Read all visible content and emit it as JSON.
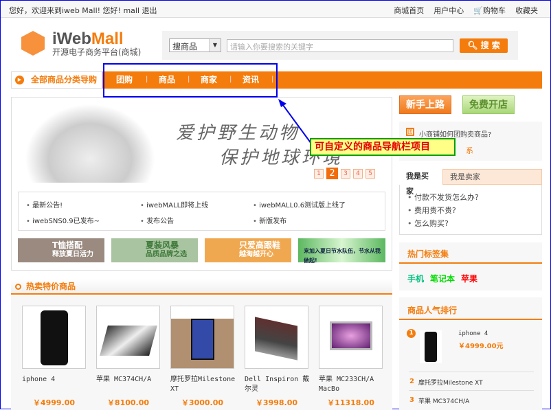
{
  "topbar": {
    "welcome": "您好，欢迎来到iweb Mall!  您好! mall 退出",
    "links": [
      "商城首页",
      "用户中心",
      "购物车",
      "收藏夹"
    ]
  },
  "logo": {
    "brand_a": "iWeb",
    "brand_b": "Mall",
    "subtitle": "开源电子商务平台(商城)"
  },
  "search": {
    "type": "搜商品",
    "placeholder": "请输入你要搜索的关键字",
    "button": "搜 索"
  },
  "nav": {
    "category": "全部商品分类导购",
    "items": [
      "团购",
      "商品",
      "商家",
      "资讯"
    ]
  },
  "banner": {
    "line1": "爱护野生动物",
    "line2": "保护地球环境",
    "pages": [
      "1",
      "2",
      "3",
      "4",
      "5"
    ],
    "active_page": "2"
  },
  "notices": [
    "最新公告!",
    "iwebMALL即将上线",
    "iwebMALL0.6测试版上线了",
    "iwebSNS0.9已发布~",
    "发布公告",
    "新版发布"
  ],
  "ads": [
    {
      "t1": "T恤搭配",
      "t2": "释放夏日活力",
      "color": "#9a8a80"
    },
    {
      "t1": "夏装风暴",
      "t2": "品质品牌之选",
      "color": "#a8c4a0"
    },
    {
      "t1": "只爱高跟鞋",
      "t2": "越淘越开心",
      "color": "#f0a850"
    },
    {
      "t1": "来加入夏日节水队伍，节水从我做起!",
      "t2": "",
      "color": "#8fd48a"
    }
  ],
  "hot": {
    "title": "热卖特价商品",
    "products": [
      {
        "name": "iphone 4",
        "price": "￥4999.00"
      },
      {
        "name": "苹果 MC374CH/A",
        "price": "￥8100.00"
      },
      {
        "name": "摩托罗拉Milestone XT",
        "price": "￥3000.00"
      },
      {
        "name": "Dell Inspiron 戴尔灵",
        "price": "￥3998.00"
      },
      {
        "name": "苹果 MC233CH/A MacBo",
        "price": "￥11318.00"
      }
    ]
  },
  "right": {
    "btn_new": "新手上路",
    "btn_open": "免费开店",
    "tip": "小商铺如何团购卖商品?",
    "tip2": "系",
    "tabs": [
      "我是买家",
      "我是卖家"
    ],
    "faq": [
      "付款不发货怎么办?",
      "费用贵不贵?",
      "怎么购买?"
    ],
    "tags_title": "热门标签集",
    "tags": [
      {
        "t": "手机",
        "c": "#00c080"
      },
      {
        "t": "笔记本",
        "c": "#00dd00"
      },
      {
        "t": "苹果",
        "c": "#ff0000"
      }
    ],
    "rank_title": "商品人气排行",
    "rank": [
      {
        "n": "1",
        "name": "iphone 4",
        "price": "￥4999.00元"
      },
      {
        "n": "2",
        "name": "摩托罗拉Milestone XT"
      },
      {
        "n": "3",
        "name": "苹果 MC374CH/A"
      }
    ]
  },
  "annotation": {
    "callout": "可自定义的商品导航栏项目"
  },
  "colors": {
    "accent": "#f47c0c",
    "annotation": "#0000ee"
  }
}
